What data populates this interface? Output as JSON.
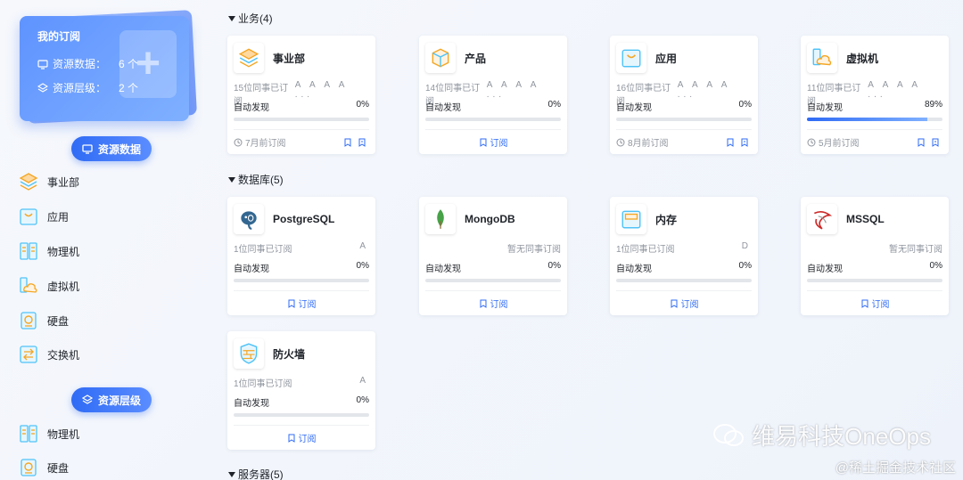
{
  "sidebar": {
    "subscription": {
      "title": "我的订阅",
      "resource_data_label": "资源数据：",
      "resource_data_value": "6 个",
      "resource_level_label": "资源层级：",
      "resource_level_value": "2 个"
    },
    "resource_data_pill": "资源数据",
    "resource_data_items": [
      {
        "label": "事业部"
      },
      {
        "label": "应用"
      },
      {
        "label": "物理机"
      },
      {
        "label": "虚拟机"
      },
      {
        "label": "硬盘"
      },
      {
        "label": "交换机"
      }
    ],
    "resource_level_pill": "资源层级",
    "resource_level_items": [
      {
        "label": "物理机"
      },
      {
        "label": "硬盘"
      }
    ]
  },
  "sections": {
    "business": "业务(4)",
    "database": "数据库(5)",
    "server": "服务器(5)"
  },
  "common": {
    "auto_discover": "自动发现",
    "subscribe": "订阅"
  },
  "business_cards": [
    {
      "name": "事业部",
      "subs": "15位同事已订阅",
      "avatars": "A A A A ...",
      "pct": "0%",
      "progress": 0,
      "time": "7月前订阅"
    },
    {
      "name": "产品",
      "subs": "14位同事已订阅",
      "avatars": "A A A A ...",
      "pct": "0%",
      "progress": 0
    },
    {
      "name": "应用",
      "subs": "16位同事已订阅",
      "avatars": "A A A A ...",
      "pct": "0%",
      "progress": 0,
      "time": "8月前订阅"
    },
    {
      "name": "虚拟机",
      "subs": "11位同事已订阅",
      "avatars": "A A A A ...",
      "pct": "89%",
      "progress": 89,
      "time": "5月前订阅"
    }
  ],
  "database_cards": [
    {
      "name": "PostgreSQL",
      "subs": "1位同事已订阅",
      "avatars": "A",
      "pct": "0%",
      "progress": 0
    },
    {
      "name": "MongoDB",
      "subs": "",
      "avatars": "暂无同事订阅",
      "pct": "0%",
      "progress": 0
    },
    {
      "name": "内存",
      "subs": "1位同事已订阅",
      "avatars": "D",
      "pct": "0%",
      "progress": 0
    },
    {
      "name": "MSSQL",
      "subs": "",
      "avatars": "暂无同事订阅",
      "pct": "0%",
      "progress": 0
    },
    {
      "name": "防火墙",
      "subs": "1位同事已订阅",
      "avatars": "A",
      "pct": "0%",
      "progress": 0
    }
  ],
  "watermark": {
    "brand": "维易科技OneOps",
    "site": "@稀土掘金技术社区"
  },
  "colors": {
    "accent": "#2f6bf5",
    "icon_orange": "#f5a623",
    "icon_cyan": "#4fc3f7"
  }
}
